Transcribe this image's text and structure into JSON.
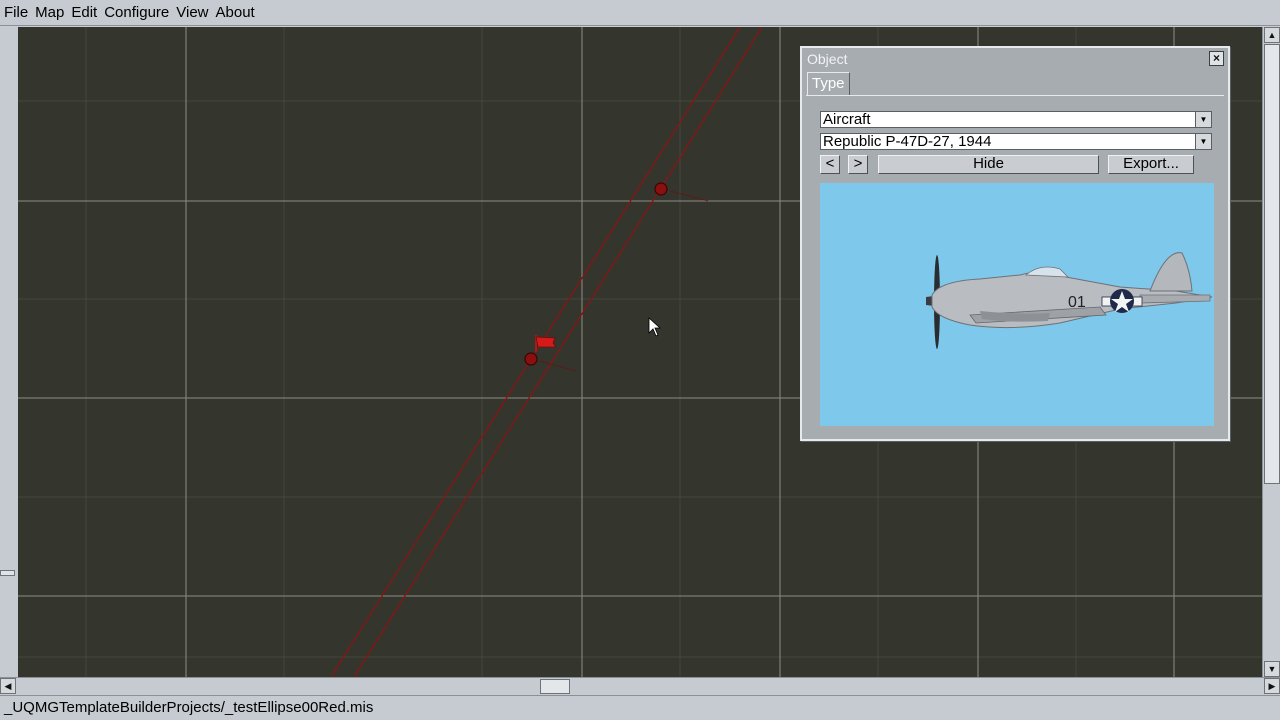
{
  "menubar": {
    "items": [
      "File",
      "Map",
      "Edit",
      "Configure",
      "View",
      "About"
    ]
  },
  "map": {
    "waypoint_labels": [
      "",
      ""
    ]
  },
  "object_dialog": {
    "title": "Object",
    "close_icon": "close-icon",
    "tab_label": "Type",
    "category_value": "Aircraft",
    "model_value": "Republic P-47D-27, 1944",
    "prev_label": "<",
    "next_label": ">",
    "hide_label": "Hide",
    "export_label": "Export...",
    "aircraft_marking": "01"
  },
  "statusbar": {
    "path": "_UQMGTemplateBuilderProjects/_testEllipse00Red.mis"
  },
  "colors": {
    "map_background": "#34352d",
    "route_red": "#8a1414",
    "preview_sky": "#7ec8ec"
  }
}
